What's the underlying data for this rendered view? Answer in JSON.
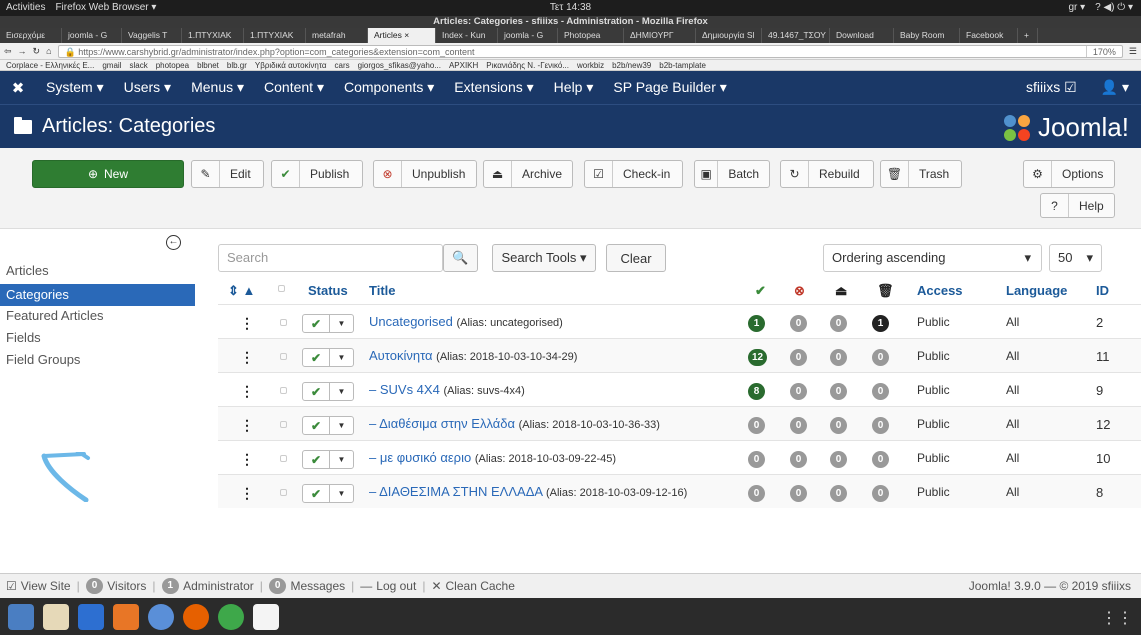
{
  "system": {
    "activities": "Activities",
    "browser_menu": "Firefox Web Browser ▾",
    "clock": "Τετ 14:38",
    "locale": "gr ▾",
    "status_icons": "? ◀) ⏻ ▾"
  },
  "browser": {
    "window_title": "Articles: Categories - sfiiixs - Administration - Mozilla Firefox",
    "tabs": [
      "Εισερχόμε",
      "joomla - G",
      "Vaggelis T",
      "1.ΠΤΥΧΙΑΚ",
      "1.ΠΤΥΧΙΑΚ",
      "metafrah",
      "Articles ×",
      "Index - Kun",
      "joomla - G",
      "Photopea",
      "ΔΗΜΙΟΥΡΓ",
      "Δημιουργία Sl",
      "49.1467_ΤΣΟΥ",
      "Download",
      "Baby Room",
      "Facebook",
      "+"
    ],
    "url": "https://www.carshybrid.gr/administrator/index.php?option=com_categories&extension=com_content",
    "zoom": "170%",
    "bookmarks": [
      "Corplace - Ελληνικές E...",
      "gmail",
      "slack",
      "photopea",
      "blbnet",
      "blb.gr",
      "Υβριδικά αυτοκίνητα",
      "cars",
      "giorgos_sfikas@yaho...",
      "ΑΡΧΙΚΗ",
      "Ρικανιάδης Ν. -Γενικό...",
      "workbiz",
      "b2b/new39",
      "b2b-tamplate"
    ]
  },
  "nav": {
    "logo": "✖",
    "items": [
      "System ▾",
      "Users ▾",
      "Menus ▾",
      "Content ▾",
      "Components ▾",
      "Extensions ▾",
      "Help ▾",
      "SP Page Builder ▾"
    ],
    "user_site": "sfiiixs ☑",
    "user_menu": "👤 ▾"
  },
  "header": {
    "title": "Articles: Categories",
    "brand": "Joomla!"
  },
  "toolbar": {
    "new": "New",
    "edit": "Edit",
    "publish": "Publish",
    "unpublish": "Unpublish",
    "archive": "Archive",
    "checkin": "Check-in",
    "batch": "Batch",
    "rebuild": "Rebuild",
    "trash": "Trash",
    "options": "Options",
    "help": "Help"
  },
  "sidebar": {
    "items": [
      "Articles",
      "Categories",
      "Featured Articles",
      "Fields",
      "Field Groups"
    ],
    "active": "Categories"
  },
  "filters": {
    "search_placeholder": "Search",
    "search_tools": "Search Tools ▾",
    "clear": "Clear",
    "ordering": "Ordering ascending",
    "limit": "50"
  },
  "table": {
    "headers": {
      "sort": "⇕ ▲",
      "status": "Status",
      "title": "Title",
      "access": "Access",
      "language": "Language",
      "id": "ID"
    },
    "rows": [
      {
        "title": "Uncategorised",
        "alias": "(Alias: uncategorised)",
        "published": "1",
        "unpublished": "0",
        "archived": "0",
        "trashed": "1",
        "access": "Public",
        "language": "All",
        "id": "2"
      },
      {
        "title": "Αυτοκίνητα",
        "alias": "(Alias: 2018-10-03-10-34-29)",
        "published": "12",
        "unpublished": "0",
        "archived": "0",
        "trashed": "0",
        "access": "Public",
        "language": "All",
        "id": "11"
      },
      {
        "title": "– SUVs 4X4",
        "alias": "(Alias: suvs-4x4)",
        "published": "8",
        "unpublished": "0",
        "archived": "0",
        "trashed": "0",
        "access": "Public",
        "language": "All",
        "id": "9"
      },
      {
        "title": "– Διαθέσιμα στην Ελλάδα",
        "alias": "(Alias: 2018-10-03-10-36-33)",
        "published": "0",
        "unpublished": "0",
        "archived": "0",
        "trashed": "0",
        "access": "Public",
        "language": "All",
        "id": "12"
      },
      {
        "title": "– με φυσικό αεριο",
        "alias": "(Alias: 2018-10-03-09-22-45)",
        "published": "0",
        "unpublished": "0",
        "archived": "0",
        "trashed": "0",
        "access": "Public",
        "language": "All",
        "id": "10"
      },
      {
        "title": "– ΔΙΑΘΕΣΙΜΑ ΣΤΗΝ ΕΛΛΑΔΑ",
        "alias": "(Alias: 2018-10-03-09-12-16)",
        "published": "0",
        "unpublished": "0",
        "archived": "0",
        "trashed": "0",
        "access": "Public",
        "language": "All",
        "id": "8"
      }
    ]
  },
  "footer": {
    "view_site": "View Site",
    "visitors_count": "0",
    "visitors": "Visitors",
    "admin_count": "1",
    "admin": "Administrator",
    "messages_count": "0",
    "messages": "Messages",
    "logout": "Log out",
    "clean_cache": "Clean Cache",
    "version": "Joomla! 3.9.0 — © 2019 sfiiixs"
  },
  "colors": {
    "nav_bg": "#1a3867",
    "new_button": "#2f7d32",
    "active_sidebar": "#2a69b8",
    "badge_published": "#2a6b2f",
    "annotation_arrow": "#6cb8e8"
  }
}
